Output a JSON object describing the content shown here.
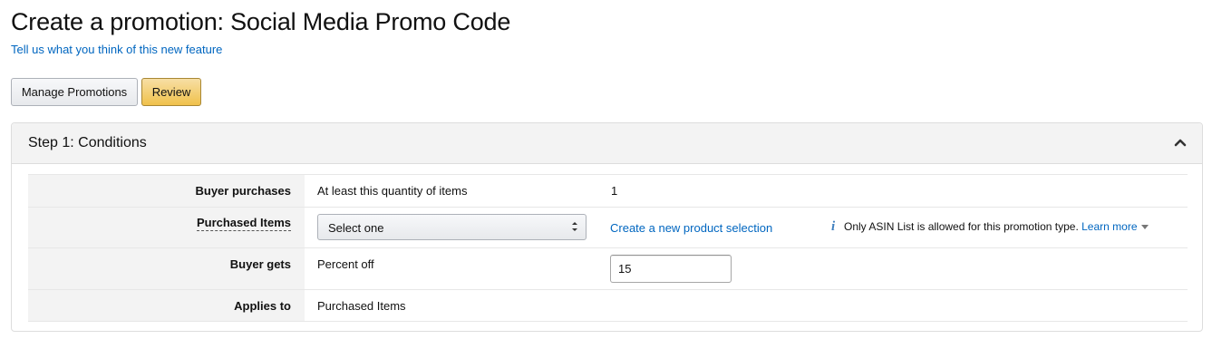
{
  "page": {
    "title": "Create a promotion: Social Media Promo Code",
    "feedback_link": "Tell us what you think of this new feature"
  },
  "toolbar": {
    "manage_label": "Manage Promotions",
    "review_label": "Review"
  },
  "step": {
    "title": "Step 1: Conditions",
    "collapse_icon": "chevron-up-icon"
  },
  "rows": {
    "buyer_purchases": {
      "label": "Buyer purchases",
      "condition": "At least this quantity of items",
      "value": "1"
    },
    "purchased_items": {
      "label": "Purchased Items",
      "select_value": "Select one",
      "create_link": "Create a new product selection",
      "info_icon": "info-icon",
      "info_text": "Only ASIN List is allowed for this promotion type.",
      "learn_more": "Learn more"
    },
    "buyer_gets": {
      "label": "Buyer gets",
      "benefit": "Percent off",
      "input_value": "15"
    },
    "applies_to": {
      "label": "Applies to",
      "value": "Purchased Items"
    }
  },
  "colors": {
    "link": "#0066c0",
    "review_button": "#f0c14b",
    "label_background": "#f3f3f3"
  }
}
